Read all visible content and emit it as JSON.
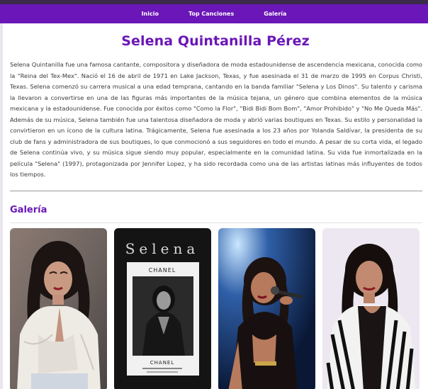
{
  "nav": {
    "items": [
      "Inicio",
      "Top Canciones",
      "Galería"
    ]
  },
  "page": {
    "title": "Selena Quintanilla Pérez",
    "bio": "Selena Quintanilla fue una famosa cantante, compositora y diseñadora de moda estadounidense de ascendencia mexicana, conocida como la \"Reina del Tex-Mex\". Nació el 16 de abril de 1971 en Lake Jackson, Texas, y fue asesinada el 31 de marzo de 1995 en Corpus Christi, Texas. Selena comenzó su carrera musical a una edad temprana, cantando en la banda familiar \"Selena y Los Dinos\". Su talento y carisma la llevaron a convertirse en una de las figuras más importantes de la música tejana, un género que combina elementos de la música mexicana y la estadounidense. Fue conocida por éxitos como \"Como la Flor\", \"Bidi Bidi Bom Bom\", \"Amor Prohibido\" y \"No Me Queda Más\". Además de su música, Selena también fue una talentosa diseñadora de moda y abrió varias boutiques en Texas. Su estilo y personalidad la convirtieron en un ícono de la cultura latina. Trágicamente, Selena fue asesinada a los 23 años por Yolanda Saldívar, la presidenta de su club de fans y administradora de sus boutiques, lo que conmocionó a sus seguidores en todo el mundo. A pesar de su corta vida, el legado de Selena continúa vivo, y su música sigue siendo muy popular, especialmente en la comunidad latina. Su vida fue inmortalizada en la película \"Selena\" (1997), protagonizada por Jennifer Lopez, y ha sido recordada como una de las artistas latinas más influyentes de todos los tiempos."
  },
  "gallery": {
    "title": "Galería",
    "photos": [
      {
        "name": "photo-white-jacket"
      },
      {
        "name": "photo-chanel-magazine",
        "text_top": "Selena",
        "text_brand": "CHANEL",
        "text_brand2": "CHANEL"
      },
      {
        "name": "photo-singing-microphone"
      },
      {
        "name": "photo-striped-jacket"
      }
    ]
  },
  "colors": {
    "accent": "#6a16b8",
    "topbar": "#3b2a4a",
    "text": "#3a3a3a"
  }
}
